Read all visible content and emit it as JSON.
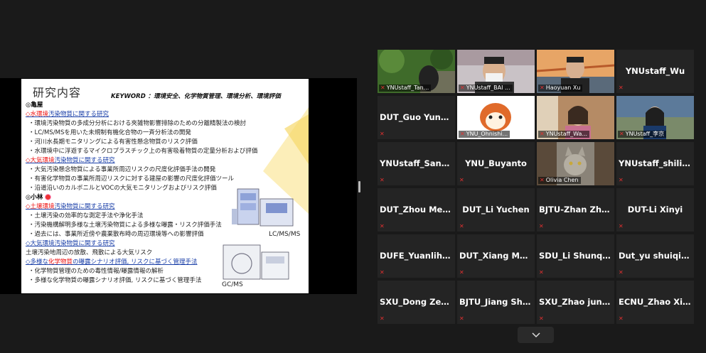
{
  "slide": {
    "title": "研究内容",
    "keyword": "KEYWORD ：環境安全、化学物質管理、環境分析、環境評価",
    "lines": [
      {
        "type": "head",
        "text": "◎亀屋"
      },
      {
        "type": "sec",
        "red": "◇水環境",
        "text": "汚染物質に関する研究"
      },
      {
        "type": "bul",
        "text": "・環境汚染物質の多成分分析における夾雑物影響排除のための分離精製法の検討"
      },
      {
        "type": "bul",
        "text": "・LC/MS/MSを用いた未規制有機化合物の一斉分析法の開発"
      },
      {
        "type": "bul",
        "text": "・河川水長期モニタリングによる有害性懸念物質のリスク評価"
      },
      {
        "type": "bul",
        "text": "・水環境中に浮遊するマイクロプラスチック上の有害吸着物質の定量分析および評価"
      },
      {
        "type": "sec",
        "red": "◇大気環境",
        "text": "汚染物質に関する研究"
      },
      {
        "type": "bul",
        "text": "・大気汚染懸念物質による事業所周辺リスクの尺度化評価手法の開発"
      },
      {
        "type": "bul",
        "text": "・有害化学物質の事業所周辺リスクに対する建屋の影響の尺度化評価ツール"
      },
      {
        "type": "bul",
        "text": "・沿道沿いのカルボニルとVOCの大気モニタリングおよびリスク評価"
      },
      {
        "type": "head",
        "text": "◎小林"
      },
      {
        "type": "sec",
        "red": "◇土壌環境",
        "text": "汚染物質に関する研究"
      },
      {
        "type": "bul",
        "text": "・土壌汚染の効率的な測定手法や浄化手法"
      },
      {
        "type": "bul",
        "text": "・汚染機構解明多様な土壌汚染物質による多様な曝露・リスク評価手法"
      },
      {
        "type": "bul",
        "text": "・過去には、事業所近傍や農薬散布時の周辺環境等への影響評価"
      },
      {
        "type": "sec",
        "red": "",
        "text": "◇大気環境汚染物質に関する研究"
      },
      {
        "type": "plain",
        "text": "土壌汚染地周辺の放散、飛散による大気リスク"
      },
      {
        "type": "sec",
        "red": "化学物質",
        "text": "◇多様な",
        "tail": "の曝露シナリオ評価, リスクに基づく管理手法"
      },
      {
        "type": "bul",
        "text": "・化学物質管理のための毒性情報/曝露情報の解析"
      },
      {
        "type": "bul",
        "text": "・多様な化学物質の曝露シナリオ評価, リスクに基づく管理手法"
      }
    ],
    "lcms_label": "LC/MS/MS",
    "gcms_label": "GC/MS"
  },
  "participants": [
    {
      "name": "YNUstaff_Tan...",
      "video": true,
      "kind": "outdoor"
    },
    {
      "name": "YNUstaff_BAI ...",
      "video": true,
      "kind": "man-mask"
    },
    {
      "name": "Haoyuan Xu",
      "video": true,
      "kind": "man-bridge"
    },
    {
      "name": "YNUstaff_Wu",
      "video": false
    },
    {
      "name": "DUT_Guo Yunmi...",
      "video": false
    },
    {
      "name": "YNU_Ohnishi...",
      "video": true,
      "kind": "cartoon"
    },
    {
      "name": "YNUstaff_Wa...",
      "video": true,
      "kind": "woman-room"
    },
    {
      "name": "YNUstaff_李京",
      "video": true,
      "kind": "woman-city",
      "active": true
    },
    {
      "name": "YNUstaff_Sang DI",
      "video": false
    },
    {
      "name": "YNU_Buyanto",
      "video": false
    },
    {
      "name": "Olivia Chen",
      "video": true,
      "kind": "cat"
    },
    {
      "name": "YNUstaff_shiliwen",
      "video": false
    },
    {
      "name": "DUT_Zhou Meiqi",
      "video": false
    },
    {
      "name": "DUT_Li Yuchen",
      "video": false
    },
    {
      "name": "BJTU-Zhan  Zhe...",
      "video": false
    },
    {
      "name": "DUT-Li Xinyi",
      "video": false
    },
    {
      "name": "DUFE_Yuanlihua",
      "video": false
    },
    {
      "name": "DUT_Xiang Meng",
      "video": false
    },
    {
      "name": "SDU_Li  Shunqia...",
      "video": false
    },
    {
      "name": "Dut_yu shuiqing",
      "video": false
    },
    {
      "name": "SXU_Dong  Zeng...",
      "video": false
    },
    {
      "name": "BJTU_Jiang Shiyu",
      "video": false
    },
    {
      "name": "SXU_Zhao  junqi...",
      "video": false
    },
    {
      "name": "ECNU_Zhao Xinyi",
      "video": false
    }
  ],
  "icons": {
    "mic": "mic-muted-icon",
    "chevron": "chevron-down-icon"
  },
  "colors": {
    "active_speaker": "#d6d64a",
    "muted": "#e03030"
  }
}
